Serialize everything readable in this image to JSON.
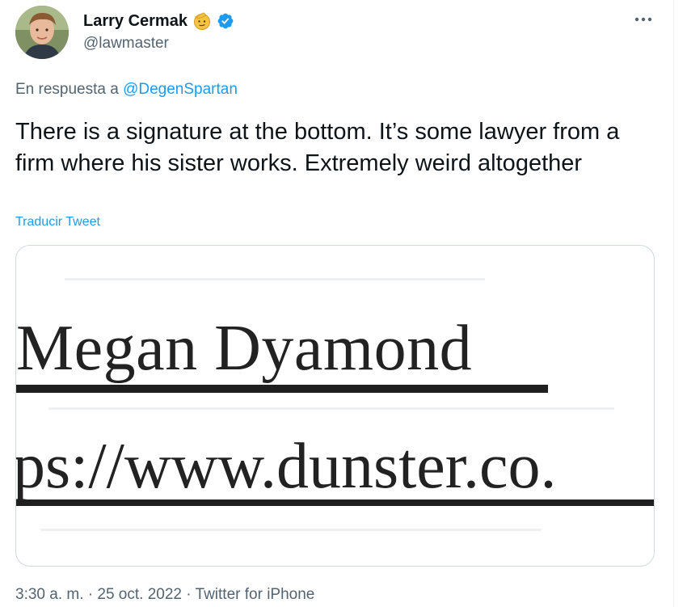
{
  "author": {
    "display_name": "Larry Cermak",
    "handle": "@lawmaster",
    "verified": true,
    "badge_icon": "saluting-face-emoji-icon",
    "avatar_icon": "profile-avatar"
  },
  "more_menu": {
    "icon": "more-horizontal-icon"
  },
  "reply": {
    "prefix": "En respuesta a",
    "mention": "@DegenSpartan"
  },
  "tweet": {
    "text": "There is a signature at the bottom. It’s some lawyer from a firm where his sister works. Extremely weird altogether",
    "translate_label": "Traducir Tweet"
  },
  "media": {
    "signature_name": "Megan Dyamond",
    "signature_url": "ps://www.dunster.co."
  },
  "meta": {
    "time": "3:30 a. m.",
    "separator": "·",
    "date": "25 oct. 2022",
    "source": "Twitter for iPhone"
  },
  "colors": {
    "text": "#0f1419",
    "secondary": "#536471",
    "link": "#1d9bf0",
    "border": "#cfd9de"
  }
}
